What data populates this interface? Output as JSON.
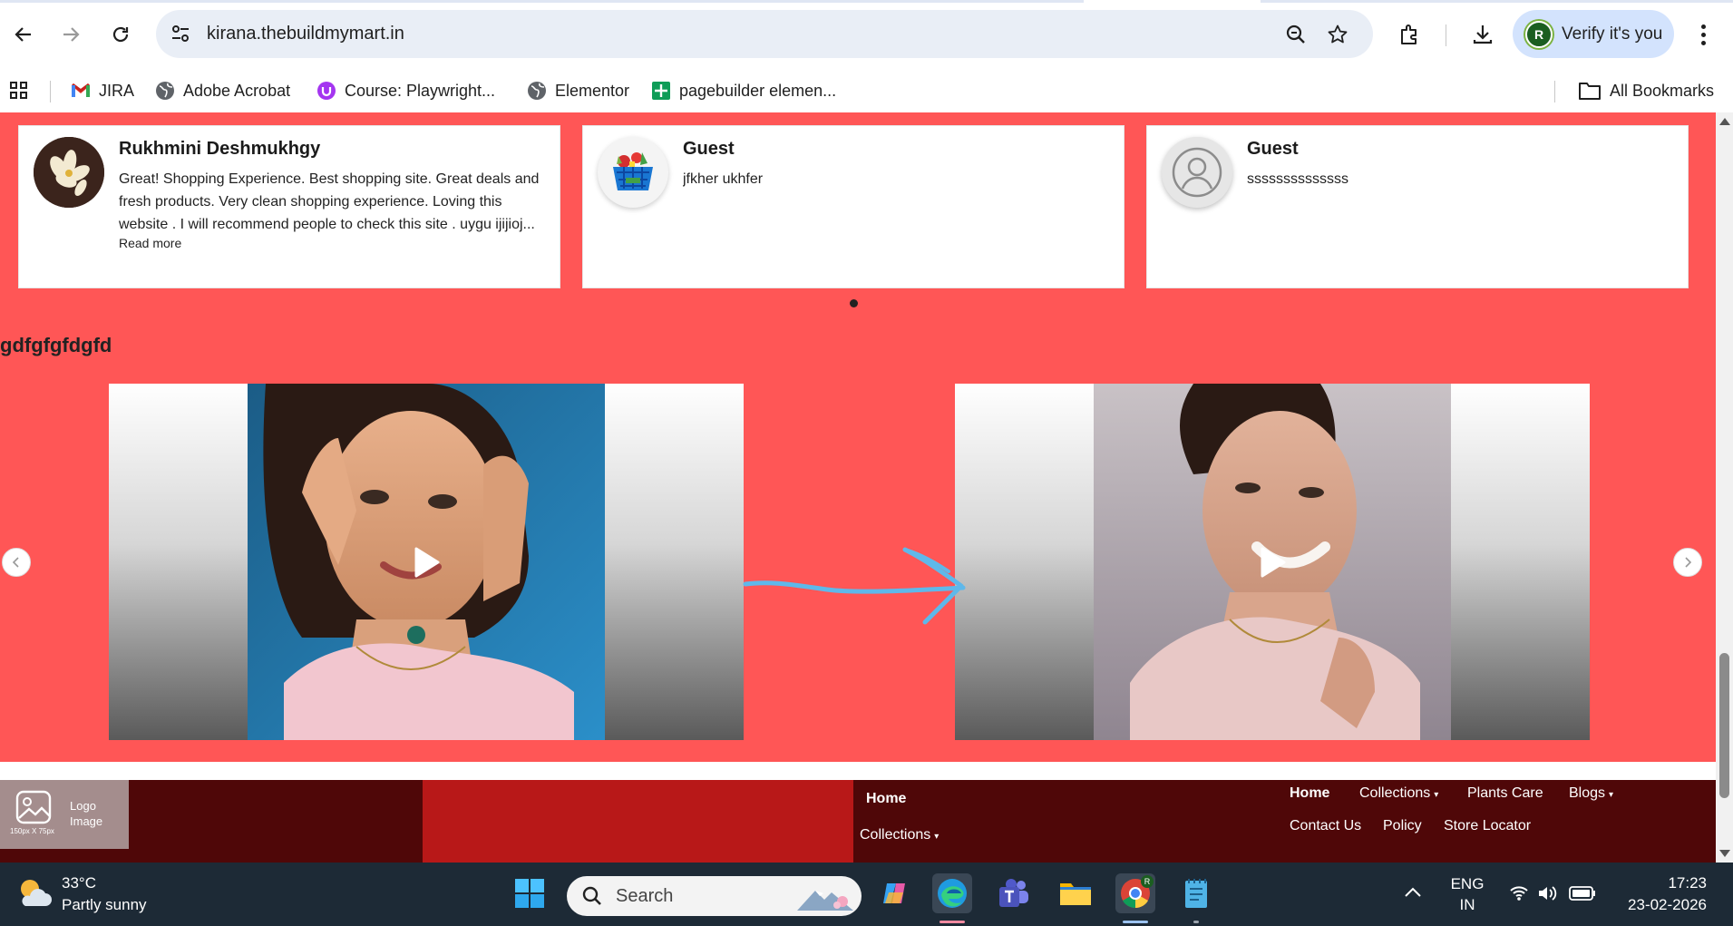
{
  "browser": {
    "url": "kirana.thebuildmymart.in",
    "verify_label": "Verify it's you",
    "verify_avatar_letter": "R",
    "bookmarks": [
      {
        "label": "JIRA",
        "icon": "gmail-icon"
      },
      {
        "label": "Adobe Acrobat",
        "icon": "globe-icon"
      },
      {
        "label": "Course: Playwright...",
        "icon": "udemy-icon"
      },
      {
        "label": "Elementor",
        "icon": "globe-icon"
      },
      {
        "label": "pagebuilder elemen...",
        "icon": "sheets-icon"
      }
    ],
    "all_bookmarks_label": "All Bookmarks"
  },
  "reviews": [
    {
      "name": "Rukhmini Deshmukhgy",
      "text": "Great! Shopping Experience. Best shopping site. Great deals and fresh products. Very clean shopping experience. Loving this website . I will recommend people to check this site . uygu ijijioj...",
      "read_more": "Read more",
      "avatar": "flower-photo"
    },
    {
      "name": "Guest",
      "text": "jfkher ukhfer",
      "avatar": "grocery-basket-icon"
    },
    {
      "name": "Guest",
      "text": "ssssssssssssss",
      "avatar": "user-placeholder-icon"
    }
  ],
  "video_section": {
    "heading": "gdfgfgfdgfd"
  },
  "footer": {
    "logo_label": "Logo Image",
    "logo_size_hint": "150px X 75px",
    "menu_a": {
      "home": "Home",
      "collections": "Collections"
    },
    "menu_b": {
      "row1": [
        "Home",
        "Collections",
        "Plants Care",
        "Blogs"
      ],
      "row2": [
        "Contact Us",
        "Policy",
        "Store Locator"
      ]
    }
  },
  "taskbar": {
    "temperature": "33°C",
    "weather": "Partly sunny",
    "search_label": "Search",
    "lang_line1": "ENG",
    "lang_line2": "IN",
    "time": "17:23",
    "date": "23-02-2026"
  },
  "colors": {
    "section_bg": "#ff5656",
    "footer_bg": "#4f0708",
    "footer_block": "#b81818",
    "annotation_arrow": "#5fb8ea"
  }
}
